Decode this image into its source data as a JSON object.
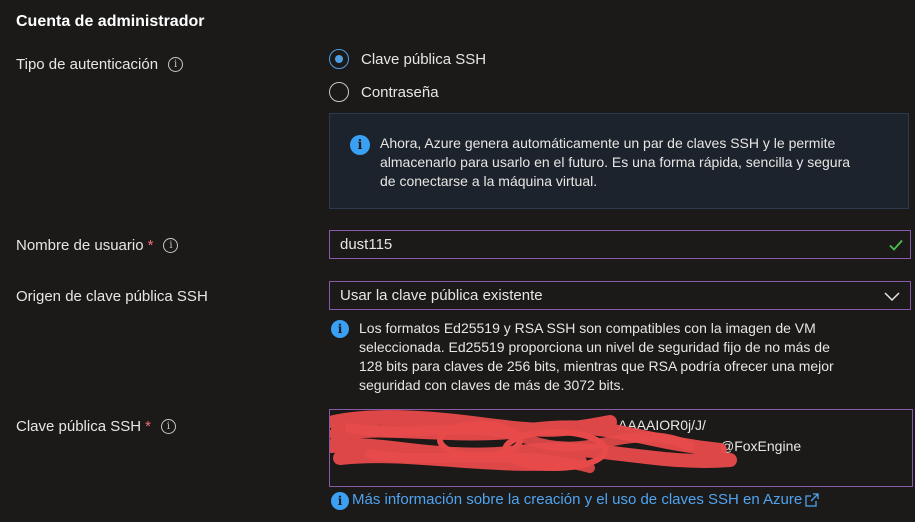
{
  "section": {
    "title": "Cuenta de administrador"
  },
  "auth": {
    "label": "Tipo de autenticación",
    "options": [
      {
        "label": "Clave pública SSH",
        "selected": true
      },
      {
        "label": "Contraseña",
        "selected": false
      }
    ],
    "info_lines": [
      "Ahora, Azure genera automáticamente un par de claves SSH y le permite",
      "almacenarlo para usarlo en el futuro. Es una forma rápida, sencilla y segura",
      "de conectarse a la máquina virtual."
    ]
  },
  "username": {
    "label": "Nombre de usuario",
    "required_mark": "*",
    "value": "dust115",
    "status": "valid"
  },
  "ssh_source": {
    "label": "Origen de clave pública SSH",
    "selected": "Usar la clave pública existente",
    "note_lines": [
      "Los formatos Ed25519 y RSA SSH son compatibles con la imagen de VM",
      "seleccionada. Ed25519 proporciona un nivel de seguridad fijo de no más de",
      "128 bits para claves de 256 bits, mientras que RSA podría ofrecer una mejor",
      "seguridad con claves de más de 3072 bits."
    ]
  },
  "ssh_key": {
    "label": "Clave pública SSH",
    "required_mark": "*",
    "visible_line1_end": "AAAAIOR0j/J/",
    "visible_line2_end": "@FoxEngine",
    "redacted": true
  },
  "link": {
    "text": "Más información sobre la creación y el uso de claves SSH en Azure"
  },
  "colors": {
    "accent": "#4f9ee3",
    "field_border": "#8a5aa8",
    "valid": "#4cbf4c",
    "required": "#f1707b",
    "redaction": "#e84a4a"
  }
}
